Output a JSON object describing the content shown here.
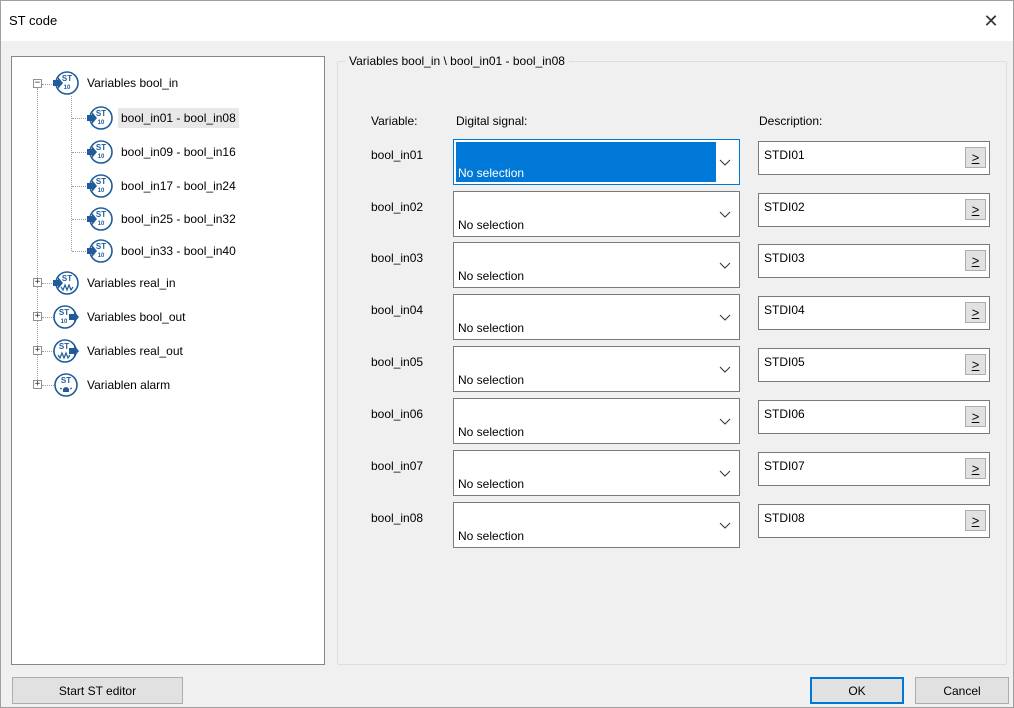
{
  "window": {
    "title": "ST code",
    "close_glyph": "✕"
  },
  "tree": {
    "root": {
      "label": "Variables bool_in",
      "toggle": "−",
      "icon": "st-bool-in-icon"
    },
    "children": [
      {
        "label": "bool_in01 - bool_in08",
        "selected": true,
        "icon": "st-bool-in-icon"
      },
      {
        "label": "bool_in09 - bool_in16",
        "icon": "st-bool-in-icon"
      },
      {
        "label": "bool_in17 - bool_in24",
        "icon": "st-bool-in-icon"
      },
      {
        "label": "bool_in25 - bool_in32",
        "icon": "st-bool-in-icon"
      },
      {
        "label": "bool_in33 - bool_in40",
        "icon": "st-bool-in-icon"
      }
    ],
    "others": [
      {
        "label": "Variables real_in",
        "toggle": "+",
        "icon": "st-real-in-icon"
      },
      {
        "label": "Variables bool_out",
        "toggle": "+",
        "icon": "st-bool-out-icon"
      },
      {
        "label": "Variables real_out",
        "toggle": "+",
        "icon": "st-real-out-icon"
      },
      {
        "label": "Variablen alarm",
        "toggle": "+",
        "icon": "st-alarm-icon"
      }
    ]
  },
  "panel": {
    "title": "Variables bool_in \\ bool_in01 - bool_in08",
    "headers": {
      "variable": "Variable:",
      "signal": "Digital signal:",
      "description": "Description:"
    },
    "browse_label": ">",
    "rows": [
      {
        "variable": "bool_in01",
        "signal": "No selection",
        "description": "STDI01",
        "focused": true
      },
      {
        "variable": "bool_in02",
        "signal": "No selection",
        "description": "STDI02"
      },
      {
        "variable": "bool_in03",
        "signal": "No selection",
        "description": "STDI03"
      },
      {
        "variable": "bool_in04",
        "signal": "No selection",
        "description": "STDI04"
      },
      {
        "variable": "bool_in05",
        "signal": "No selection",
        "description": "STDI05"
      },
      {
        "variable": "bool_in06",
        "signal": "No selection",
        "description": "STDI06"
      },
      {
        "variable": "bool_in07",
        "signal": "No selection",
        "description": "STDI07"
      },
      {
        "variable": "bool_in08",
        "signal": "No selection",
        "description": "STDI08"
      }
    ]
  },
  "buttons": {
    "start_editor": "Start ST editor",
    "ok": "OK",
    "cancel": "Cancel"
  },
  "colors": {
    "accent": "#0078d7",
    "icon_blue": "#1f5c99",
    "selection": "#e8e8e8"
  }
}
